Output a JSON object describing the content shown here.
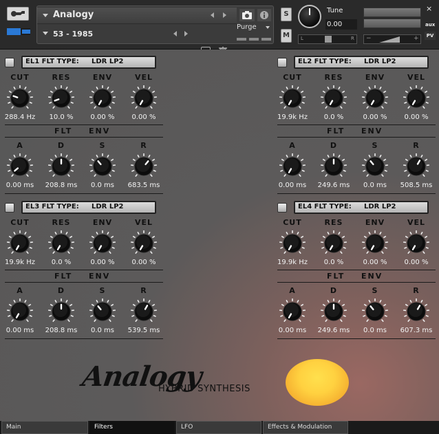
{
  "header": {
    "instrument_name": "Analogy",
    "preset_name": "53 - 1985",
    "purge_label": "Purge",
    "solo_label": "S",
    "mute_label": "M",
    "tune_label": "Tune",
    "tune_value": "0.00",
    "pan_left": "L",
    "pan_right": "R",
    "vol_minus": "−",
    "vol_plus": "+",
    "aux_label": "aux",
    "pv_label": "PV",
    "close_label": "×"
  },
  "knob_labels": {
    "cut": "CUT",
    "res": "RES",
    "env": "ENV",
    "vel": "VEL",
    "a": "A",
    "d": "D",
    "s": "S",
    "r": "R",
    "flt": "FLT",
    "env2": "ENV"
  },
  "sections": [
    {
      "prefix": "EL1 FLT TYPE:",
      "type": "LDR LP2",
      "cut": "288.4 Hz",
      "res": "10.0 %",
      "env": "0.00 %",
      "vel": "0.00 %",
      "a": "0.00 ms",
      "d": "208.8 ms",
      "s": "0.0 ms",
      "r": "683.5 ms"
    },
    {
      "prefix": "EL2 FLT TYPE:",
      "type": "LDR LP2",
      "cut": "19.9k Hz",
      "res": "0.0 %",
      "env": "0.00 %",
      "vel": "0.00 %",
      "a": "0.00 ms",
      "d": "249.6 ms",
      "s": "0.0 ms",
      "r": "508.5 ms"
    },
    {
      "prefix": "EL3 FLT TYPE:",
      "type": "LDR LP2",
      "cut": "19.9k Hz",
      "res": "0.0 %",
      "env": "0.00 %",
      "vel": "0.00 %",
      "a": "0.00 ms",
      "d": "208.8 ms",
      "s": "0.0 ms",
      "r": "539.5 ms"
    },
    {
      "prefix": "EL4 FLT TYPE:",
      "type": "LDR LP2",
      "cut": "19.9k Hz",
      "res": "0.0 %",
      "env": "0.00 %",
      "vel": "0.00 %",
      "a": "0.00 ms",
      "d": "249.6 ms",
      "s": "0.0 ms",
      "r": "607.3 ms"
    }
  ],
  "branding": {
    "logo": "Analogy",
    "tagline": "HYBRID SYNTHESIS"
  },
  "tabs": [
    {
      "label": "Main"
    },
    {
      "label": "Filters"
    },
    {
      "label": "LFO"
    },
    {
      "label": "Effects & Modulation"
    }
  ],
  "colors": {
    "accent_blue": "#2a79d6",
    "sun_yellow": "#ffd140"
  }
}
